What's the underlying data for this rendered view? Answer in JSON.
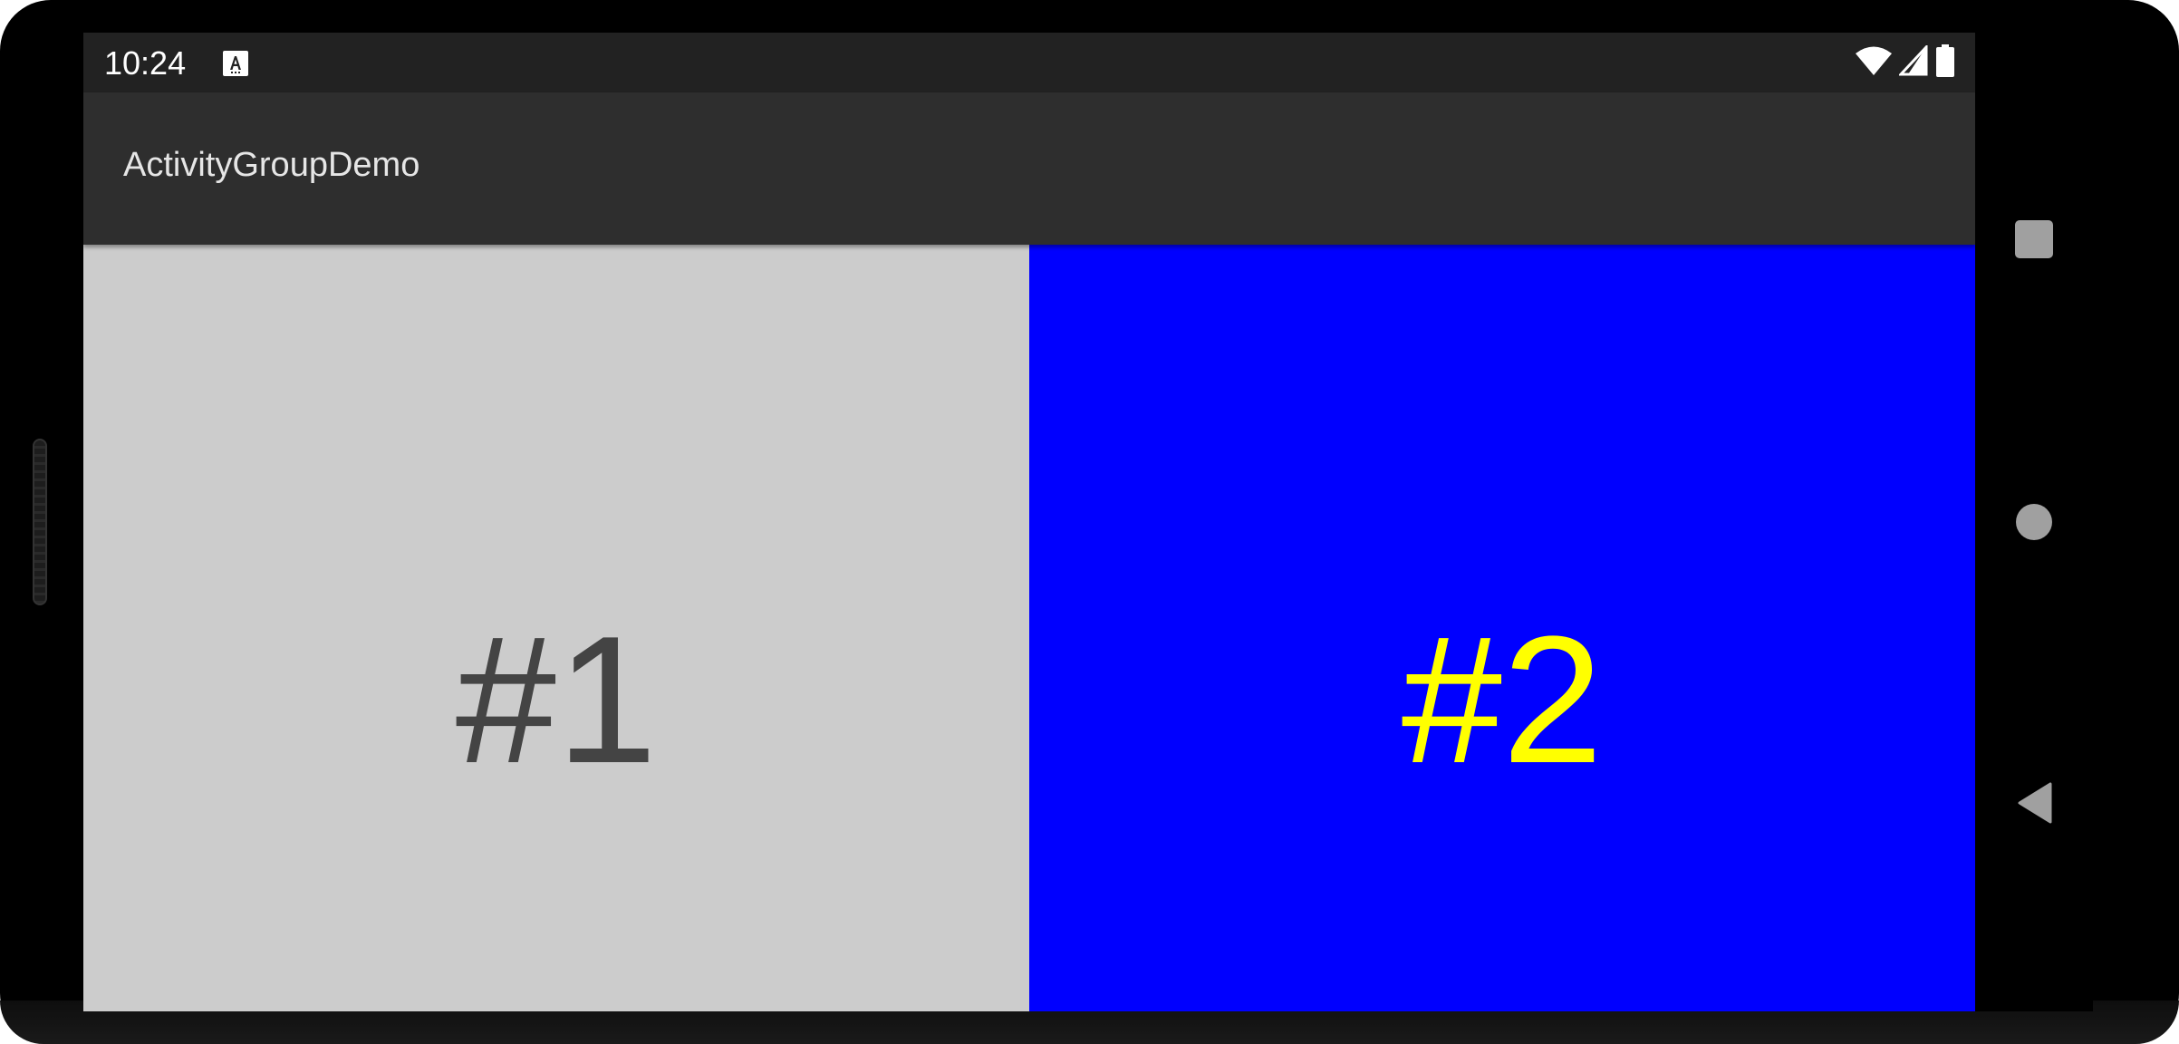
{
  "status_bar": {
    "time": "10:24",
    "icons": [
      "accessibility-notification-icon",
      "wifi-icon",
      "cell-signal-icon",
      "battery-icon"
    ]
  },
  "app_bar": {
    "title": "ActivityGroupDemo"
  },
  "panes": [
    {
      "label": "#1",
      "background": "#cccccc",
      "text_color": "#444444"
    },
    {
      "label": "#2",
      "background": "#0000ff",
      "text_color": "#ffff00"
    }
  ],
  "nav_bar": {
    "buttons": [
      "recents-button",
      "home-button",
      "back-button"
    ],
    "icon_color": "#a0a0a0"
  }
}
